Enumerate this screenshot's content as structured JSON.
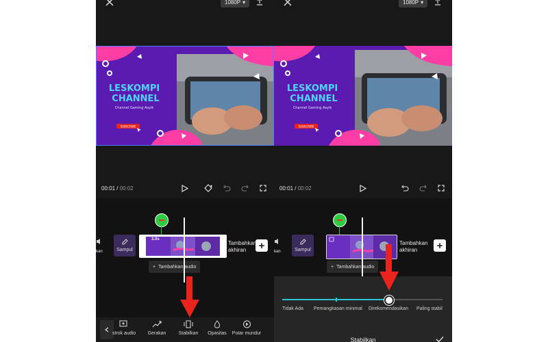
{
  "left": {
    "resolution": "1080P",
    "time_current": "00:01",
    "time_total": "00:02",
    "clip_duration": "3.0s",
    "cover_label": "Sampul",
    "add_end_label_line1": "Tambahkan",
    "add_end_label_line2": "akhiran",
    "add_audio_label": "Tambahkan audio",
    "partial_left_label": "kan",
    "toolbar": [
      {
        "label": "strok audio",
        "icon": "waveform-icon"
      },
      {
        "label": "Gerakan",
        "icon": "motion-icon"
      },
      {
        "label": "Stabilkan",
        "icon": "stabilize-icon"
      },
      {
        "label": "Opasitas",
        "icon": "opacity-icon"
      },
      {
        "label": "Putar mundur",
        "icon": "reverse-icon"
      }
    ]
  },
  "right": {
    "resolution": "1080P",
    "time_current": "00:01",
    "time_total": "00:02",
    "cover_label": "Sampul",
    "add_end_label_line1": "Tambahkan",
    "add_end_label_line2": "akhiran",
    "add_audio_label": "Tambahkan audio",
    "partial_left_label": "kan",
    "stabilize": {
      "title": "Stabilkan",
      "options": [
        "Tidak Ada",
        "Pemangkasan minimal",
        "Direkomendasikan",
        "Paling stabil"
      ],
      "selected_index": 2
    }
  },
  "thumbnail": {
    "line1": "LESKOMPI",
    "line2": "CHANNEL",
    "tagline": "Channel Gaming Asyik",
    "subscribe": "SUBSCRIBE"
  },
  "colors": {
    "arrow_red": "#e8241c",
    "slider_teal": "#2ec4d6",
    "thumb_purple": "#5b1bb0",
    "selection_blue": "#4f7cff"
  }
}
